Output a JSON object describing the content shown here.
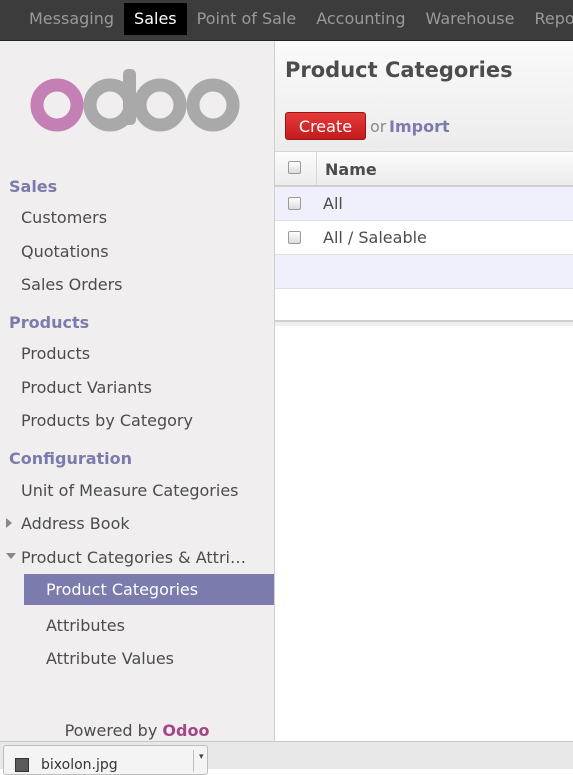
{
  "topbar": {
    "items": [
      {
        "label": "Messaging"
      },
      {
        "label": "Sales",
        "active": true
      },
      {
        "label": "Point of Sale"
      },
      {
        "label": "Accounting"
      },
      {
        "label": "Warehouse"
      },
      {
        "label": "Reporting"
      }
    ]
  },
  "sidebar": {
    "logo_text": "odoo",
    "logo_colors": {
      "o_pink": "#c47fb4",
      "gray": "#a9a9a9"
    },
    "sections": [
      {
        "title": "Sales",
        "items": [
          "Customers",
          "Quotations",
          "Sales Orders"
        ]
      },
      {
        "title": "Products",
        "items": [
          "Products",
          "Product Variants",
          "Products by Category"
        ]
      },
      {
        "title": "Configuration",
        "items": [
          "Unit of Measure Categories",
          "Address Book",
          "Product Categories & Attri…",
          "Product Categories",
          "Attributes",
          "Attribute Values"
        ]
      }
    ],
    "powered_by": "Powered by",
    "powered_brand": "Odoo",
    "accent_color": "#7c7bad"
  },
  "main": {
    "title": "Product Categories",
    "create_label": "Create",
    "or_label": "or",
    "import_label": "Import",
    "columns": [
      "Name"
    ],
    "rows": [
      {
        "name": "All"
      },
      {
        "name": "All / Saleable"
      }
    ]
  },
  "downloads": {
    "file_name": "bixolon.jpg"
  }
}
